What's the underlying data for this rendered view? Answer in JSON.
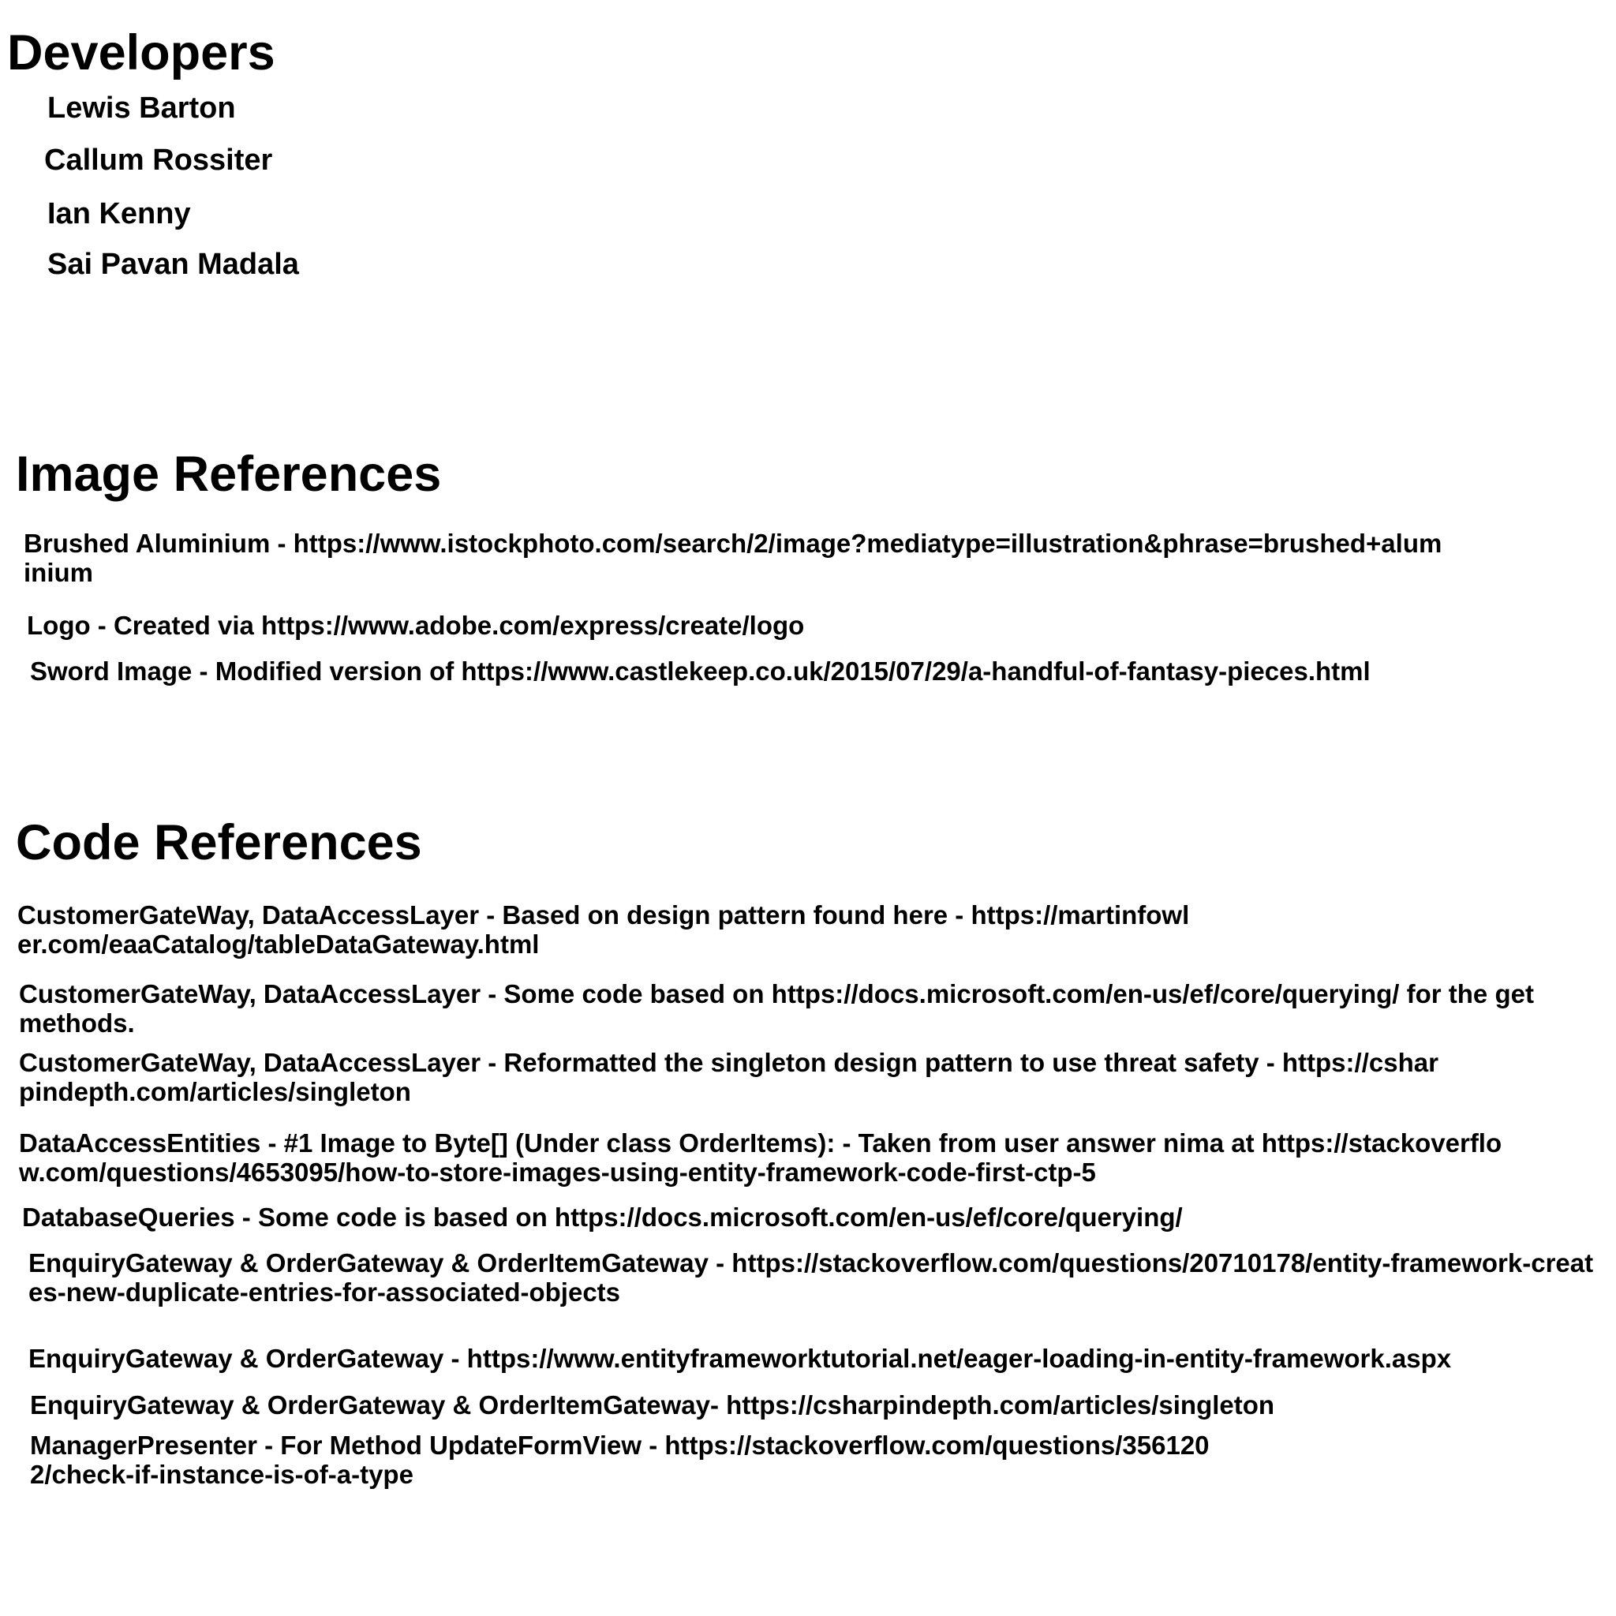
{
  "developers": {
    "heading": "Developers",
    "names": [
      "Lewis Barton",
      "Callum Rossiter",
      "Ian Kenny",
      "Sai Pavan Madala"
    ]
  },
  "image_references": {
    "heading": "Image References",
    "items": [
      "Brushed Aluminium - https://www.istockphoto.com/search/2/image?mediatype=illustration&phrase=brushed+aluminium",
      "Logo - Created via https://www.adobe.com/express/create/logo",
      "Sword Image - Modified version of https://www.castlekeep.co.uk/2015/07/29/a-handful-of-fantasy-pieces.html"
    ]
  },
  "code_references": {
    "heading": "Code References",
    "items": [
      "CustomerGateWay, DataAccessLayer - Based on design pattern found here - https://martinfowler.com/eaaCatalog/tableDataGateway.html",
      "CustomerGateWay, DataAccessLayer - Some code based on https://docs.microsoft.com/en-us/ef/core/querying/ for the get methods.",
      "CustomerGateWay, DataAccessLayer - Reformatted the singleton design pattern to use threat safety - https://csharpindepth.com/articles/singleton",
      "DataAccessEntities - #1 Image to Byte[] (Under class OrderItems): - Taken from user answer nima at https://stackoverflow.com/questions/4653095/how-to-store-images-using-entity-framework-code-first-ctp-5",
      "DatabaseQueries - Some code is based on https://docs.microsoft.com/en-us/ef/core/querying/",
      "EnquiryGateway & OrderGateway & OrderItemGateway - https://stackoverflow.com/questions/20710178/entity-framework-creates-new-duplicate-entries-for-associated-objects",
      "EnquiryGateway & OrderGateway - https://www.entityframeworktutorial.net/eager-loading-in-entity-framework.aspx",
      "EnquiryGateway & OrderGateway & OrderItemGateway- https://csharpindepth.com/articles/singleton",
      "ManagerPresenter - For Method UpdateFormView - https://stackoverflow.com/questions/3561202/check-if-instance-is-of-a-type"
    ]
  }
}
